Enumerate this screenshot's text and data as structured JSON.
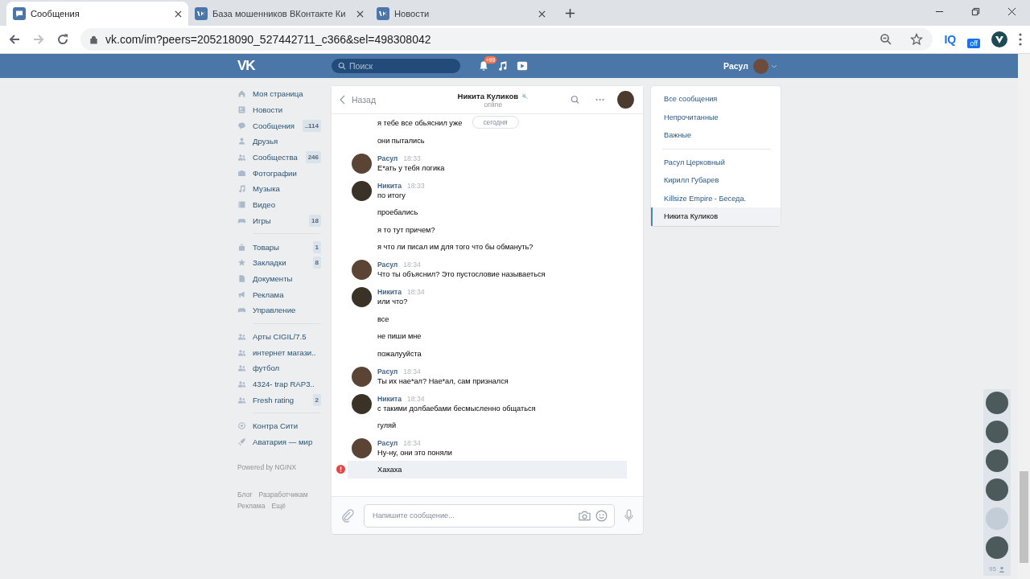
{
  "browser": {
    "tabs": [
      {
        "title": "Сообщения",
        "kind": "messages",
        "selected": true
      },
      {
        "title": "База мошенников ВКонтакте Ки",
        "kind": "vk",
        "selected": false
      },
      {
        "title": "Новости",
        "kind": "vk",
        "selected": false
      }
    ],
    "url": "vk.com/im?peers=205218090_527442711_c366&sel=498308042",
    "extensions": [
      {
        "kind": "text",
        "label": "IQ"
      },
      {
        "kind": "badge",
        "label": "off"
      }
    ]
  },
  "header": {
    "logo": "VK",
    "search_placeholder": "Поиск",
    "notifications": "+99",
    "user": "Расул"
  },
  "nav": {
    "sections": [
      [
        {
          "kind": "home",
          "label": "Моя страница"
        },
        {
          "kind": "news",
          "label": "Новости"
        },
        {
          "kind": "messages",
          "label": "Сообщения",
          "count": "..114"
        },
        {
          "kind": "person",
          "label": "Друзья"
        },
        {
          "kind": "people",
          "label": "Сообщества",
          "count": "246"
        },
        {
          "kind": "camera",
          "label": "Фотографии"
        },
        {
          "kind": "music",
          "label": "Музыка"
        },
        {
          "kind": "film",
          "label": "Видео"
        },
        {
          "kind": "gamepad",
          "label": "Игры",
          "count": "18"
        }
      ],
      [
        {
          "kind": "bag",
          "label": "Товары",
          "count": "1"
        },
        {
          "kind": "star",
          "label": "Закладки",
          "count": "8"
        },
        {
          "kind": "doc",
          "label": "Документы"
        },
        {
          "kind": "megaphone",
          "label": "Реклама"
        },
        {
          "kind": "gamepad",
          "label": "Управление"
        }
      ],
      [
        {
          "kind": "people",
          "label": "Арты CIGIL/7.5"
        },
        {
          "kind": "people",
          "label": "интернет магази.."
        },
        {
          "kind": "people",
          "label": "футбол"
        },
        {
          "kind": "people",
          "label": "4324- trap RAP3.."
        },
        {
          "kind": "people",
          "label": "Fresh rating",
          "count": "2"
        }
      ],
      [
        {
          "kind": "target",
          "label": "Контра Сити"
        },
        {
          "kind": "rocket",
          "label": "Аватария — мир"
        }
      ]
    ],
    "powered": "Powered by NGINX",
    "links": [
      "Блог",
      "Разработчикам",
      "Реклама",
      "Ещё"
    ]
  },
  "chat": {
    "back": "Назад",
    "name": "Никита Куликов",
    "muted": true,
    "status": "online",
    "date": "сегодня",
    "groups": [
      {
        "lines": [
          {
            "text": "я тебе все обьяснил уже",
            "failed": false
          },
          {
            "text": "они пытались",
            "failed": false
          }
        ]
      },
      {
        "kind": "outgoing",
        "author": "Расул",
        "time": "18:33",
        "lines": [
          {
            "text": "Е*ать у тебя логика",
            "failed": false
          }
        ]
      },
      {
        "kind": "incoming",
        "author": "Никита",
        "time": "18:33",
        "lines": [
          {
            "text": "по итогу",
            "failed": false
          },
          {
            "text": "проебались",
            "failed": false
          },
          {
            "text": "я то тут причем?",
            "failed": false
          },
          {
            "text": "я что ли писал им для того что бы обмануть?",
            "failed": false
          }
        ]
      },
      {
        "kind": "outgoing",
        "author": "Расул",
        "time": "18:34",
        "lines": [
          {
            "text": "Что ты объяснил? Это пустословие называеться",
            "failed": false
          }
        ]
      },
      {
        "kind": "incoming",
        "author": "Никита",
        "time": "18:34",
        "lines": [
          {
            "text": "или что?",
            "failed": false
          },
          {
            "text": "все",
            "failed": false
          },
          {
            "text": "не пиши мне",
            "failed": false
          },
          {
            "text": "пожалууйста",
            "failed": false
          }
        ]
      },
      {
        "kind": "outgoing",
        "author": "Расул",
        "time": "18:34",
        "lines": [
          {
            "text": "Ты их нае*ал? Нае*ал, сам признался",
            "failed": false
          }
        ]
      },
      {
        "kind": "incoming",
        "author": "Никита",
        "time": "18:34",
        "lines": [
          {
            "text": "с такими долбаебами бесмысленно общаться",
            "failed": false
          },
          {
            "text": "гуляй",
            "failed": false
          }
        ]
      },
      {
        "kind": "outgoing",
        "author": "Расул",
        "time": "18:34",
        "lines": [
          {
            "text": "Ну-ну, они это поняли",
            "failed": false
          },
          {
            "text": "Хахаха",
            "failed": true
          }
        ]
      }
    ],
    "input_placeholder": "Напишите сообщение..."
  },
  "filters": [
    {
      "label": "Все сообщения",
      "selected": false
    },
    {
      "label": "Непрочитанные",
      "selected": false
    },
    {
      "label": "Важные",
      "selected": false
    }
  ],
  "dialogs": [
    {
      "label": "Расул Церковный",
      "selected": false
    },
    {
      "label": "Кирилл Губарев",
      "selected": false
    },
    {
      "label": "Killsize Empire - Беседа.",
      "selected": false
    },
    {
      "label": "Никита Куликов",
      "selected": true
    }
  ],
  "friends": {
    "avatars": [
      {
        "kind": "photo"
      },
      {
        "kind": "photo"
      },
      {
        "kind": "photo"
      },
      {
        "kind": "photo"
      },
      {
        "kind": "default"
      },
      {
        "kind": "photo"
      }
    ],
    "online_count": "95"
  }
}
